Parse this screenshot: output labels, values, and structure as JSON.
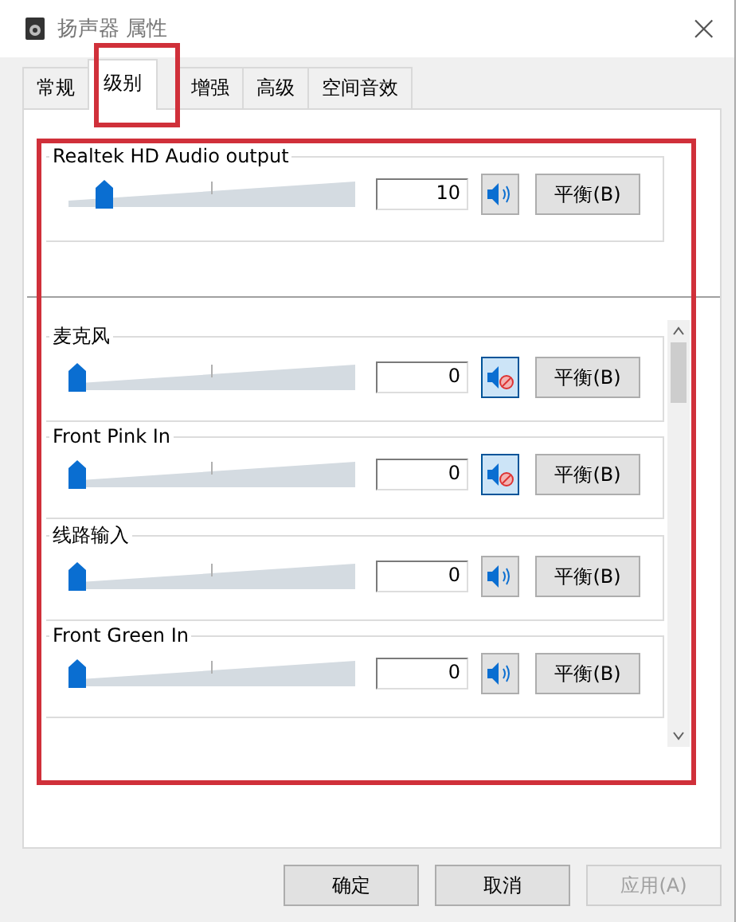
{
  "window": {
    "title": "扬声器 属性",
    "close": "×"
  },
  "tabs": [
    {
      "label": "常规",
      "selected": false
    },
    {
      "label": "级别",
      "selected": true
    },
    {
      "label": "增强",
      "selected": false
    },
    {
      "label": "高级",
      "selected": false
    },
    {
      "label": "空间音效",
      "selected": false
    }
  ],
  "main_channel": {
    "name": "Realtek HD Audio output",
    "level": 0.1,
    "reading": "10",
    "muted": false,
    "balance": "平衡(B)"
  },
  "channels": [
    {
      "name": "麦克风",
      "level": 0,
      "reading": "0",
      "muted": true,
      "balance": "平衡(B)"
    },
    {
      "name": "Front Pink In",
      "level": 0,
      "reading": "0",
      "muted": true,
      "balance": "平衡(B)"
    },
    {
      "name": "线路输入",
      "level": 0,
      "reading": "0",
      "muted": false,
      "balance": "平衡(B)"
    },
    {
      "name": "Front Green In",
      "level": 0,
      "reading": "0",
      "muted": false,
      "balance": "平衡(B)"
    }
  ],
  "buttons": [
    {
      "label": "确定",
      "disabled": false
    },
    {
      "label": "取消",
      "disabled": false
    },
    {
      "label": "应用(A)",
      "disabled": true
    }
  ]
}
